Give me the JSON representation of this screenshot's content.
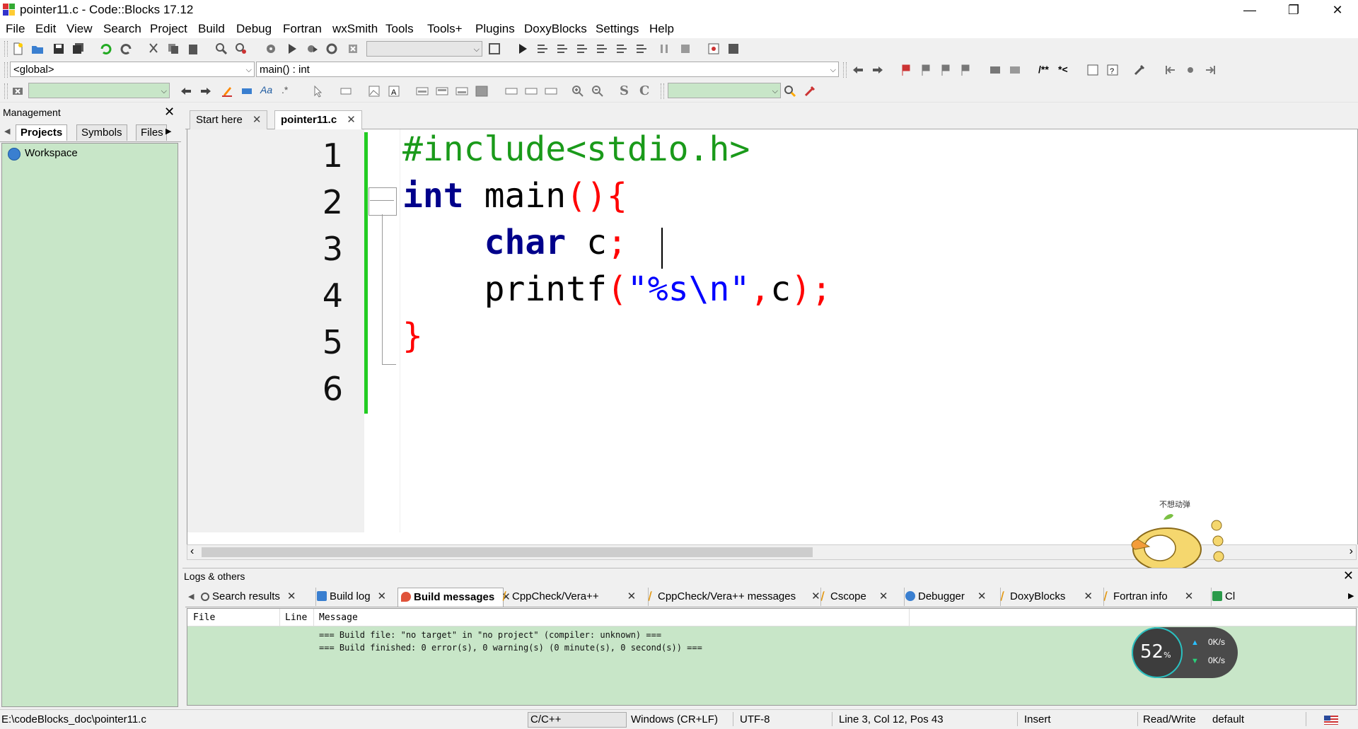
{
  "window": {
    "title": "pointer11.c - Code::Blocks 17.12",
    "min": "—",
    "max": "❐",
    "close": "✕"
  },
  "menu": [
    "File",
    "Edit",
    "View",
    "Search",
    "Project",
    "Build",
    "Debug",
    "Fortran",
    "wxSmith",
    "Tools",
    "Tools+",
    "Plugins",
    "DoxyBlocks",
    "Settings",
    "Help"
  ],
  "codecompletion": {
    "scope": "<global>",
    "function": "main() : int"
  },
  "management": {
    "title": "Management",
    "close": "✕",
    "tabs": [
      "Projects",
      "Symbols",
      "Files"
    ],
    "workspace": "Workspace"
  },
  "editor_tabs": [
    {
      "label": "Start here",
      "close": "✕"
    },
    {
      "label": "pointer11.c",
      "close": "✕"
    }
  ],
  "editor": {
    "line_numbers": [
      "1",
      "2",
      "3",
      "4",
      "5",
      "6"
    ],
    "line1": "#include<stdio.h>",
    "line2_kw": "int",
    "line2_fn": " main",
    "line2_op": "(){",
    "line3_kw": "char",
    "line3_var": " c",
    "line3_op": ";",
    "line4_fn": "printf",
    "line4_p1": "(",
    "line4_str": "\"%s\\n\"",
    "line4_comma": ",",
    "line4_var": "c",
    "line4_end": ");",
    "line5": "}"
  },
  "logs": {
    "title": "Logs & others",
    "close": "✕",
    "tabs": [
      "Search results",
      "Build log",
      "Build messages",
      "CppCheck/Vera++",
      "CppCheck/Vera++ messages",
      "Cscope",
      "Debugger",
      "DoxyBlocks",
      "Fortran info",
      "Cl"
    ],
    "tab_close": "✕",
    "columns": [
      "File",
      "Line",
      "Message"
    ],
    "messages": [
      "=== Build file: \"no target\" in \"no project\" (compiler: unknown) ===",
      "=== Build finished: 0 error(s), 0 warning(s) (0 minute(s), 0 second(s)) ==="
    ]
  },
  "status": {
    "path": "E:\\codeBlocks_doc\\pointer11.c",
    "language": "C/C++",
    "eol": "Windows (CR+LF)",
    "encoding": "UTF-8",
    "position": "Line 3, Col 12, Pos 43",
    "mode": "Insert",
    "access": "Read/Write",
    "profile": "default"
  },
  "overlays": {
    "mascot_caption": "不想动弹",
    "net_percent": "52",
    "net_percent_unit": "%",
    "up_rate": "0K/s",
    "down_rate": "0K/s"
  },
  "colors": {
    "preprocessor": "#1a9a1a",
    "keyword": "#00008b",
    "operator": "#ff0000",
    "string": "#0000ff",
    "change_bar": "#22cc22",
    "panel_green": "#c8e6c8"
  }
}
